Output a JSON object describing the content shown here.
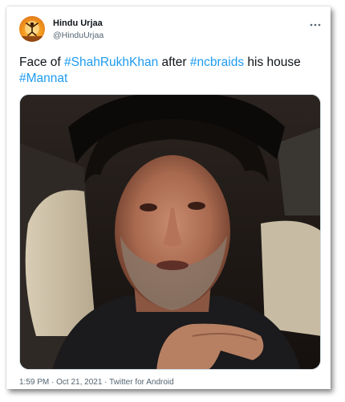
{
  "account": {
    "name": "Hindu Urjaa",
    "handle": "@HinduUrjaa",
    "avatar_icon": "avatar-meditation-silhouette"
  },
  "tweet": {
    "text_parts": {
      "p1": "Face of ",
      "tag1": "#ShahRukhKhan",
      "p2": " after ",
      "tag2": "#ncbraids",
      "p3": " his house ",
      "tag3": "#Mannat"
    },
    "media": {
      "kind": "photo",
      "description_icon": "photo-of-man-in-car"
    }
  },
  "meta": {
    "timestamp": "1:59 PM · Oct 21, 2021 · Twitter for Android"
  },
  "colors": {
    "link": "#1d9bf0",
    "text": "#0f1419",
    "secondary": "#536471"
  },
  "icons": {
    "more": "more-dots-icon"
  }
}
